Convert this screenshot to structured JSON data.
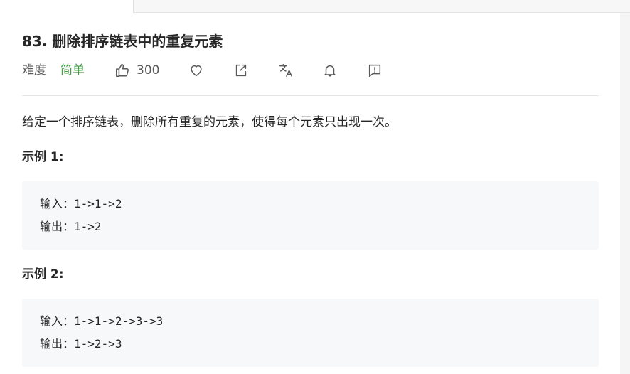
{
  "problem": {
    "title": "83. 删除排序链表中的重复元素",
    "difficulty_label": "难度",
    "difficulty": "简单",
    "difficulty_color": "#43a047",
    "likes": "300",
    "description": "给定一个排序链表，删除所有重复的元素，使得每个元素只出现一次。"
  },
  "toolbar": {
    "icons": [
      "thumbs-up-icon",
      "heart-icon",
      "share-icon",
      "translate-icon",
      "bell-icon",
      "feedback-icon"
    ]
  },
  "examples": [
    {
      "title": "示例 1:",
      "input_label": "输入：",
      "input": "1->1->2",
      "output_label": "输出：",
      "output": "1->2"
    },
    {
      "title": "示例 2:",
      "input_label": "输入：",
      "input": "1->1->2->3->3",
      "output_label": "输出：",
      "output": "1->2->3"
    }
  ]
}
